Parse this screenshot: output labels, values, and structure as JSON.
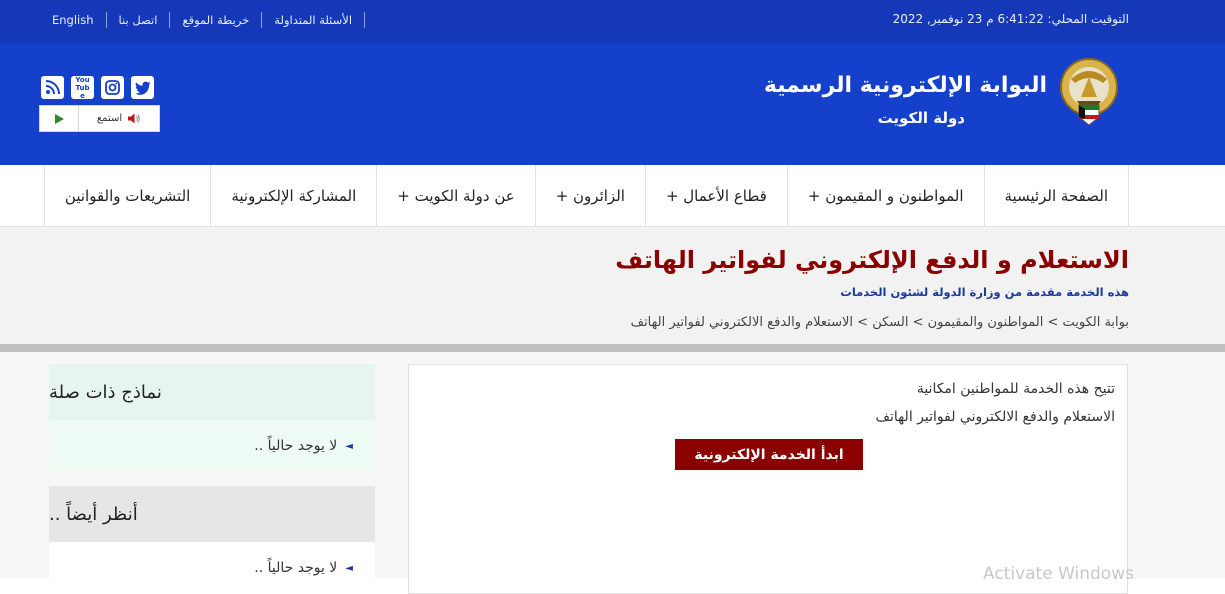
{
  "topbar": {
    "local_time": "التوقيت المحلي: 6:41:22 م 23 نوفمبر, 2022",
    "links": [
      "English",
      "اتصل بنا",
      "خريطة الموقع",
      "الأسئلة المتداولة"
    ]
  },
  "header": {
    "site_title": "البوابة الإلكترونية الرسمية",
    "site_subtitle": "دولة  الكويت",
    "listen_label": "استمع",
    "social_icons": [
      "rss-icon",
      "youtube-icon",
      "instagram-icon",
      "twitter-icon"
    ],
    "youtube_text": "You Tube"
  },
  "nav": {
    "items": [
      "الصفحة الرئيسية",
      "المواطنون و المقيمون +",
      "قطاع الأعمال +",
      "الزائرون +",
      "عن دولة الكويت +",
      "المشاركة الإلكترونية",
      "التشريعات والقوانين"
    ]
  },
  "page": {
    "title": "الاستعلام و الدفع الإلكتروني لفواتير الهاتف",
    "provider": "هذه الخدمة مقدمة من وزارة الدولة لشئون الخدمات",
    "breadcrumb": "بوابة الكويت > المواطنون والمقيمون > السكن > الاستعلام والدفع الالكتروني لفواتير الهاتف"
  },
  "service": {
    "description_line1": "تتيح هذه الخدمة للمواطنين امكانية",
    "description_line2": "الاستعلام والدفع الالكتروني لفواتير الهاتف",
    "start_button": "ابدأ الخدمة الإلكترونية"
  },
  "sidebar": {
    "related_title": "نماذج ذات صلة",
    "related_empty": "لا يوجد حالياً ..",
    "see_also_title": "أنظر أيضاً ..",
    "see_also_empty": "لا يوجد حالياً .."
  },
  "os_watermark": "Activate Windows",
  "colors": {
    "header_blue": "#1440cc",
    "accent_red": "#8b0000",
    "link_blue": "#1a3a9a"
  }
}
